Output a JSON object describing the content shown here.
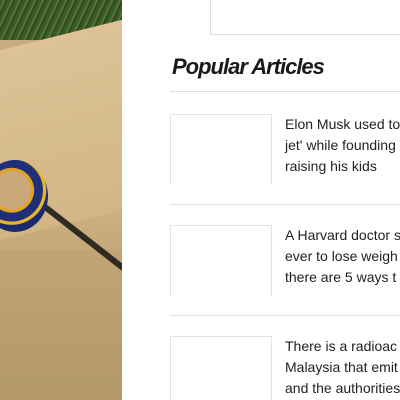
{
  "section": {
    "title": "Popular Articles"
  },
  "articles": [
    {
      "lines": [
        "Elon Musk used to",
        "jet' while founding",
        "raising his kids"
      ]
    },
    {
      "lines": [
        "A Harvard doctor s",
        "ever to lose weigh",
        "there are 5 ways t"
      ]
    },
    {
      "lines": [
        "There is a radioac",
        "Malaysia that emit",
        "and the authorities"
      ]
    }
  ]
}
